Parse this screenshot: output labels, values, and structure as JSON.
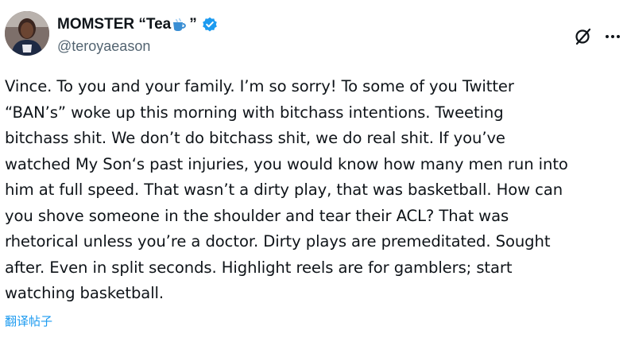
{
  "author": {
    "display_name_prefix": "MOMSTER “Tea",
    "display_name_suffix": " ”",
    "handle": "@teroyaeason",
    "verified": true,
    "emoji_icon": "teacup-icon",
    "avatar_icon": "avatar-photo"
  },
  "actions": {
    "grok_icon": "grok-icon",
    "more_icon": "more-dots-icon"
  },
  "tweet": {
    "lines": [
      "Vince. To you and your family. I’m so sorry! To some of you Twitter",
      "“BAN’s” woke up this morning with bitchass intentions. Tweeting",
      "bitchass shit. We don’t do bitchass shit, we do real shit. If you’ve",
      "watched My Son‘s past injuries, you would know how many men run into",
      "him at full speed. That wasn’t a dirty play, that was basketball. How can",
      "you shove someone in the shoulder and tear their ACL? That was",
      "rhetorical unless you’re a doctor. Dirty plays are premeditated. Sought",
      "after. Even in split seconds. Highlight reels are for gamblers; start",
      "watching basketball."
    ],
    "translate_label": "翻译帖子"
  },
  "colors": {
    "text": "#0f1419",
    "secondary": "#536471",
    "link": "#1d9bf0",
    "verified_badge": "#1d9bf0"
  }
}
